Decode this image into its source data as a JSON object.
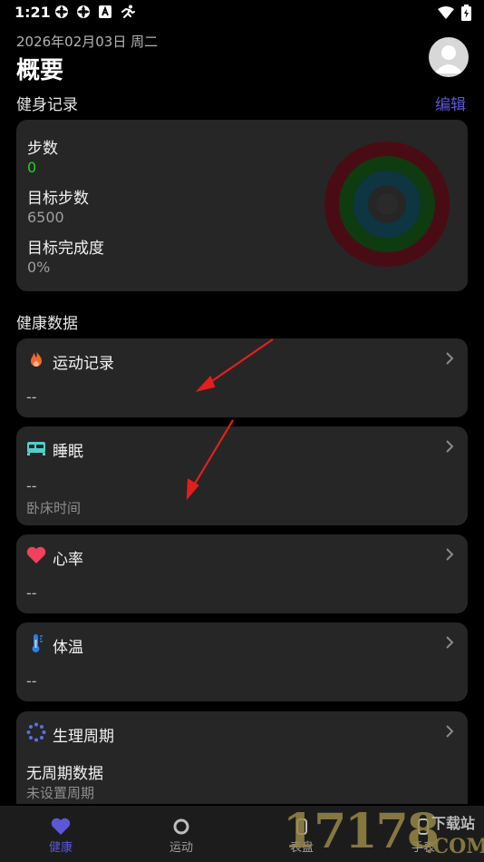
{
  "status_bar": {
    "time": "1:21"
  },
  "header": {
    "date": "2026年02月03日 周二",
    "title": "概要"
  },
  "fitness": {
    "section_label": "健身记录",
    "edit_label": "编辑",
    "steps_label": "步数",
    "steps_value": "0",
    "goal_label": "目标步数",
    "goal_value": "6500",
    "completion_label": "目标完成度",
    "completion_value": "0%"
  },
  "health": {
    "section_label": "健康数据",
    "cards": [
      {
        "title": "运动记录",
        "value": "--",
        "icon": "flame-icon"
      },
      {
        "title": "睡眠",
        "value": "--",
        "sub": "卧床时间",
        "icon": "bed-icon"
      },
      {
        "title": "心率",
        "value": "--",
        "icon": "heart-icon"
      },
      {
        "title": "体温",
        "value": "--",
        "icon": "thermometer-icon"
      },
      {
        "title": "生理周期",
        "value": "无周期数据",
        "sub": "未设置周期",
        "icon": "cycle-icon"
      }
    ]
  },
  "bottom_nav": [
    {
      "label": "健康",
      "icon": "heart-icon",
      "active": true
    },
    {
      "label": "运动",
      "icon": "ring-icon",
      "active": false
    },
    {
      "label": "表盘",
      "icon": "watch-icon",
      "active": false
    },
    {
      "label": "手表",
      "icon": "watch-icon",
      "active": false
    }
  ],
  "watermark": {
    "digits": "17178",
    "site_top": "下载站",
    "site_bottom": ".COM"
  },
  "colors": {
    "accent": "#5b57d8",
    "green": "#21d321",
    "card": "#262626",
    "arrow": "#e41e1e"
  }
}
